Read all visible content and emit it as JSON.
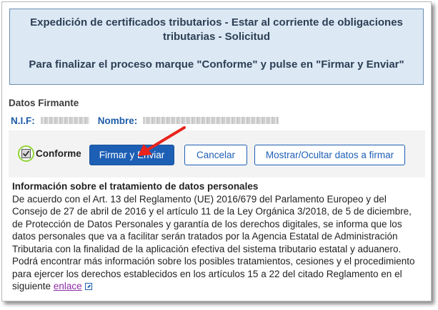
{
  "header": {
    "title": "Expedición de certificados tributarios - Estar al corriente de obligaciones tributarias - Solicitud",
    "instruction": "Para finalizar el proceso marque \"Conforme\" y pulse en \"Firmar y Enviar\""
  },
  "signer": {
    "section_title": "Datos Firmante",
    "nif_label": "N.I.F:",
    "name_label": "Nombre:"
  },
  "actions": {
    "conforme_label": "Conforme",
    "conforme_checked": true,
    "sign_button": "Firmar y Enviar",
    "cancel_button": "Cancelar",
    "toggle_button": "Mostrar/Ocultar datos a firmar"
  },
  "privacy": {
    "title": "Información sobre el tratamiento de datos personales",
    "body": "De acuerdo con el Art. 13 del Reglamento (UE) 2016/679 del Parlamento Europeo y del Consejo de 27 de abril de 2016 y el artículo 11 de la Ley Orgánica 3/2018, de 5 de diciembre, de Protección de Datos Personales y garantía de los derechos digitales, se informa que los datos personales que va a facilitar serán tratados por la Agencia Estatal de Administración Tributaria con la finalidad de la aplicación efectiva del sistema tributario estatal y aduanero. Podrá encontrar más información sobre los posibles tratamientos, cesiones y el procedimiento para ejercer los derechos establecidos en los artículos 15 a 22 del citado Reglamento en el siguiente",
    "link_text": "enlace"
  },
  "icons": {
    "checkbox": "check-icon",
    "external_link": "external-link-icon",
    "annotation": "red-arrow-icon"
  },
  "colors": {
    "header_bg": "#dce8f4",
    "header_border": "#6d8fb3",
    "header_text": "#2d3f55",
    "primary": "#1d5fb5",
    "highlight_ring": "#90d436",
    "annotation_arrow": "#e8231c",
    "link": "#8b2ea5"
  }
}
